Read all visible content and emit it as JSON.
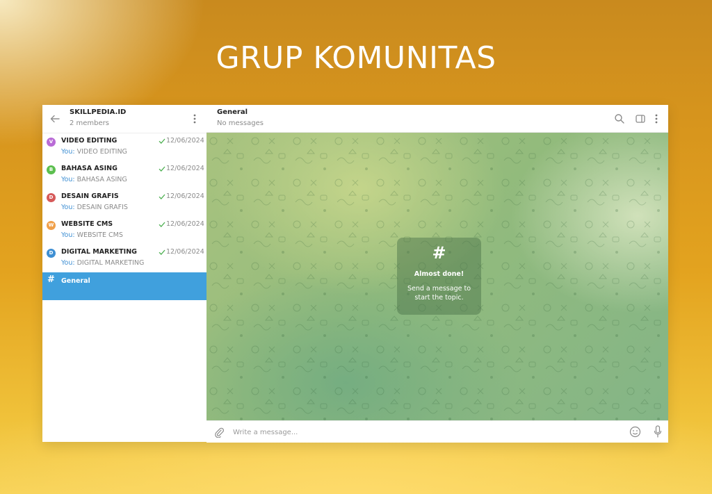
{
  "page": {
    "heading": "GRUP KOMUNITAS"
  },
  "group": {
    "title": "SKILLPEDIA.ID",
    "subtitle": "2 members"
  },
  "topics": [
    {
      "initial": "V",
      "name": "VIDEO EDITING",
      "date": "12/06/2024",
      "you": "You:",
      "preview": " VIDEO EDITING",
      "color": "#b96bd6"
    },
    {
      "initial": "B",
      "name": "BAHASA ASING",
      "date": "12/06/2024",
      "you": "You:",
      "preview": " BAHASA ASING",
      "color": "#5cbf4f"
    },
    {
      "initial": "D",
      "name": "DESAIN GRAFIS",
      "date": "12/06/2024",
      "you": "You:",
      "preview": " DESAIN GRAFIS",
      "color": "#d65a5a"
    },
    {
      "initial": "W",
      "name": "WEBSITE CMS",
      "date": "12/06/2024",
      "you": "You:",
      "preview": " WEBSITE CMS",
      "color": "#f0a04a"
    },
    {
      "initial": "D",
      "name": "DIGITAL MARKETING",
      "date": "12/06/2024",
      "you": "You:",
      "preview": " DIGITAL MARKETING",
      "color": "#3e8fd3"
    }
  ],
  "active_topic": {
    "hash": "#",
    "name": "General",
    "color": "#40a0dd"
  },
  "chat": {
    "title": "General",
    "subtitle": "No messages",
    "notice": {
      "hash": "#",
      "title": "Almost done!",
      "body": "Send a message to start the topic."
    },
    "composer_placeholder": "Write a message..."
  },
  "icons": {
    "back": "arrow-left-icon",
    "menu": "kebab-icon",
    "search": "search-icon",
    "sidebar": "sidebar-toggle-icon",
    "attach": "paperclip-icon",
    "emoji": "emoji-icon",
    "mic": "microphone-icon",
    "check": "check-icon"
  }
}
